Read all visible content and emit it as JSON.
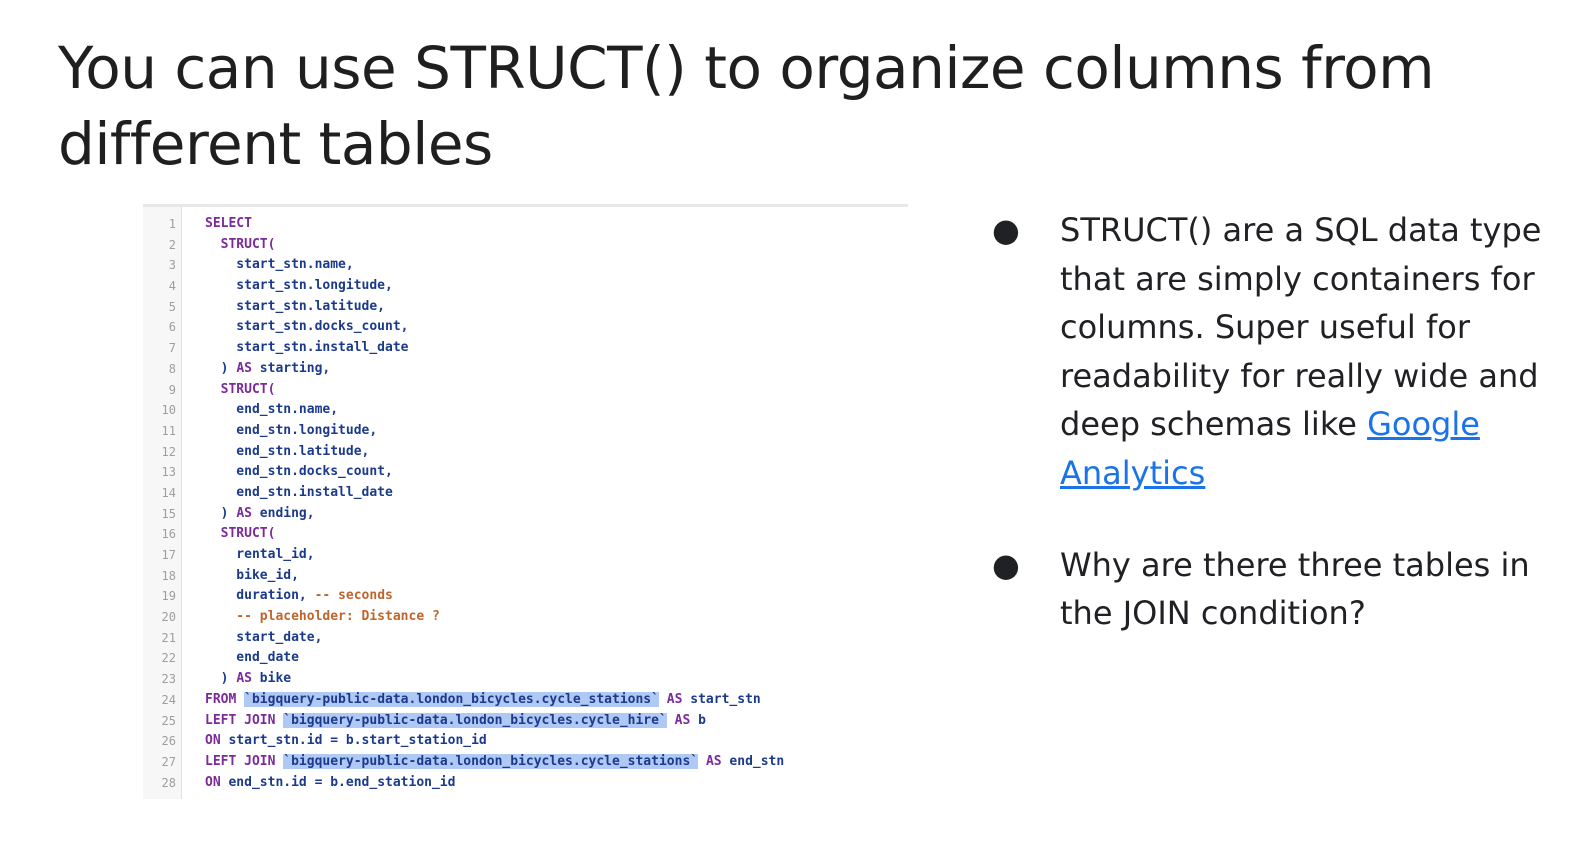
{
  "slide": {
    "title": "You can use STRUCT() to organize columns from different tables"
  },
  "code": {
    "lines": [
      {
        "n": "1",
        "parts": [
          {
            "t": "SELECT",
            "c": "kw"
          }
        ]
      },
      {
        "n": "2",
        "parts": [
          {
            "t": "  STRUCT(",
            "c": "kw"
          }
        ]
      },
      {
        "n": "3",
        "parts": [
          {
            "t": "    start_stn.name,",
            "c": "tx"
          }
        ]
      },
      {
        "n": "4",
        "parts": [
          {
            "t": "    start_stn.longitude,",
            "c": "tx"
          }
        ]
      },
      {
        "n": "5",
        "parts": [
          {
            "t": "    start_stn.latitude,",
            "c": "tx"
          }
        ]
      },
      {
        "n": "6",
        "parts": [
          {
            "t": "    start_stn.docks_count,",
            "c": "tx"
          }
        ]
      },
      {
        "n": "7",
        "parts": [
          {
            "t": "    start_stn.install_date",
            "c": "tx"
          }
        ]
      },
      {
        "n": "8",
        "parts": [
          {
            "t": "  ) ",
            "c": "tx"
          },
          {
            "t": "AS",
            "c": "kw"
          },
          {
            "t": " starting,",
            "c": "tx"
          }
        ]
      },
      {
        "n": "9",
        "parts": [
          {
            "t": "  STRUCT(",
            "c": "kw"
          }
        ]
      },
      {
        "n": "10",
        "parts": [
          {
            "t": "    end_stn.name,",
            "c": "tx"
          }
        ]
      },
      {
        "n": "11",
        "parts": [
          {
            "t": "    end_stn.longitude,",
            "c": "tx"
          }
        ]
      },
      {
        "n": "12",
        "parts": [
          {
            "t": "    end_stn.latitude,",
            "c": "tx"
          }
        ]
      },
      {
        "n": "13",
        "parts": [
          {
            "t": "    end_stn.docks_count,",
            "c": "tx"
          }
        ]
      },
      {
        "n": "14",
        "parts": [
          {
            "t": "    end_stn.install_date",
            "c": "tx"
          }
        ]
      },
      {
        "n": "15",
        "parts": [
          {
            "t": "  ) ",
            "c": "tx"
          },
          {
            "t": "AS",
            "c": "kw"
          },
          {
            "t": " ending,",
            "c": "tx"
          }
        ]
      },
      {
        "n": "16",
        "parts": [
          {
            "t": "  STRUCT(",
            "c": "kw"
          }
        ]
      },
      {
        "n": "17",
        "parts": [
          {
            "t": "    rental_id,",
            "c": "tx"
          }
        ]
      },
      {
        "n": "18",
        "parts": [
          {
            "t": "    bike_id,",
            "c": "tx"
          }
        ]
      },
      {
        "n": "19",
        "parts": [
          {
            "t": "    duration, ",
            "c": "tx"
          },
          {
            "t": "-- seconds",
            "c": "cm"
          }
        ]
      },
      {
        "n": "20",
        "parts": [
          {
            "t": "    -- placeholder: Distance ?",
            "c": "cm"
          }
        ]
      },
      {
        "n": "21",
        "parts": [
          {
            "t": "    start_date,",
            "c": "tx"
          }
        ]
      },
      {
        "n": "22",
        "parts": [
          {
            "t": "    end_date",
            "c": "tx"
          }
        ]
      },
      {
        "n": "23",
        "parts": [
          {
            "t": "  ) ",
            "c": "tx"
          },
          {
            "t": "AS",
            "c": "kw"
          },
          {
            "t": " bike",
            "c": "tx"
          }
        ]
      },
      {
        "n": "24",
        "parts": [
          {
            "t": "FROM",
            "c": "kw"
          },
          {
            "t": " ",
            "c": "tx"
          },
          {
            "t": "`bigquery-public-data.london_bicycles.cycle_stations`",
            "c": "hl"
          },
          {
            "t": " ",
            "c": "tx"
          },
          {
            "t": "AS",
            "c": "kw"
          },
          {
            "t": " start_stn",
            "c": "tx"
          }
        ]
      },
      {
        "n": "25",
        "parts": [
          {
            "t": "LEFT JOIN",
            "c": "kw"
          },
          {
            "t": " ",
            "c": "tx"
          },
          {
            "t": "`bigquery-public-data.london_bicycles.cycle_hire`",
            "c": "hl"
          },
          {
            "t": " ",
            "c": "tx"
          },
          {
            "t": "AS",
            "c": "kw"
          },
          {
            "t": " b",
            "c": "tx"
          }
        ]
      },
      {
        "n": "26",
        "parts": [
          {
            "t": "ON",
            "c": "kw"
          },
          {
            "t": " start_stn.id = b.start_station_id",
            "c": "tx"
          }
        ]
      },
      {
        "n": "27",
        "parts": [
          {
            "t": "LEFT JOIN",
            "c": "kw"
          },
          {
            "t": " ",
            "c": "tx"
          },
          {
            "t": "`bigquery-public-data.london_bicycles.cycle_stations`",
            "c": "hl"
          },
          {
            "t": " ",
            "c": "tx"
          },
          {
            "t": "AS",
            "c": "kw"
          },
          {
            "t": " end_stn",
            "c": "tx"
          }
        ]
      },
      {
        "n": "28",
        "parts": [
          {
            "t": "ON",
            "c": "kw"
          },
          {
            "t": " end_stn.id = b.end_station_id",
            "c": "tx"
          }
        ]
      }
    ]
  },
  "bullets": [
    {
      "text": "STRUCT() are a SQL data type that are simply containers for columns. Super useful for readability for really wide and deep schemas like ",
      "link": "Google Analytics"
    },
    {
      "text": "Why are there three tables in the JOIN condition?",
      "link": ""
    }
  ],
  "icons": {
    "bullet": "bullet-dot-icon"
  }
}
